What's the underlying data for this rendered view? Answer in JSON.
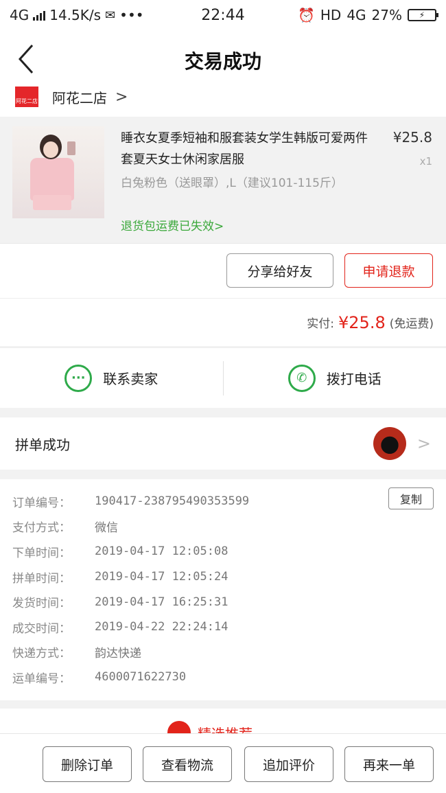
{
  "status_bar": {
    "network": "4G",
    "speed": "14.5K/s",
    "dots": "•••",
    "time": "22:44",
    "hd": "HD",
    "net_right": "4G",
    "battery": "27%"
  },
  "header": {
    "title": "交易成功"
  },
  "store": {
    "logo_text": "阿花二店",
    "name": "阿花二店",
    "arrow": ">"
  },
  "product": {
    "title": "睡衣女夏季短袖和服套装女学生韩版可爱两件套夏天女士休闲家居服",
    "sku": "白兔粉色（送眼罩）,L（建议101-115斤）",
    "refund_notice": "退货包运费已失效",
    "refund_arrow": ">",
    "price": "¥25.8",
    "quantity": "x1"
  },
  "actions": {
    "share_label": "分享给好友",
    "refund_label": "申请退款"
  },
  "payment": {
    "label": "实付:",
    "amount": "¥25.8",
    "note": "(免运费)"
  },
  "contact": {
    "seller_label": "联系卖家",
    "call_label": "拨打电话"
  },
  "group": {
    "label": "拼单成功",
    "arrow": ">"
  },
  "order_info": {
    "copy_label": "复制",
    "rows": [
      {
        "label": "订单编号：",
        "value": "190417-238795490353599"
      },
      {
        "label": "支付方式：",
        "value": "微信"
      },
      {
        "label": "下单时间：",
        "value": "2019-04-17 12:05:08"
      },
      {
        "label": "拼单时间：",
        "value": "2019-04-17 12:05:24"
      },
      {
        "label": "发货时间：",
        "value": "2019-04-17 16:25:31"
      },
      {
        "label": "成交时间：",
        "value": "2019-04-22 22:24:14"
      },
      {
        "label": "快递方式：",
        "value": "韵达快递"
      },
      {
        "label": "运单编号：",
        "value": "4600071622730"
      }
    ]
  },
  "peek": {
    "text": "精选推荐"
  },
  "bottom": {
    "delete_label": "删除订单",
    "logistics_label": "查看物流",
    "review_label": "追加评价",
    "rebuy_label": "再来一单"
  },
  "colors": {
    "accent_red": "#e2231a",
    "green": "#2eaa4a",
    "refund_green": "#3aa83a"
  }
}
